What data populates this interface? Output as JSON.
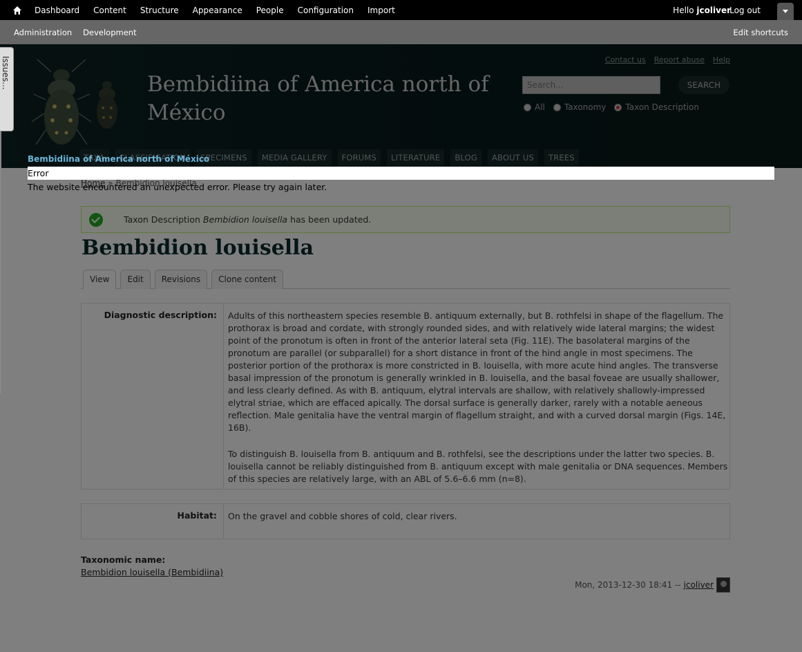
{
  "toolbar": {
    "menu": [
      "Dashboard",
      "Content",
      "Structure",
      "Appearance",
      "People",
      "Configuration",
      "Import"
    ],
    "hello_prefix": "Hello",
    "username": "jcoliver",
    "logout": "Log out",
    "shortcuts": [
      "Administration",
      "Development"
    ],
    "edit_shortcuts": "Edit shortcuts"
  },
  "header": {
    "site_name": "Bembidiina of America north of México",
    "secondary_links": [
      "Contact us",
      "Report abuse",
      "Help"
    ],
    "search_placeholder": "Search...",
    "search_button": "SEARCH",
    "search_options": [
      {
        "label": "All",
        "selected": false
      },
      {
        "label": "Taxonomy",
        "selected": false
      },
      {
        "label": "Taxon Description",
        "selected": true
      }
    ],
    "nav": [
      "TAXA",
      "CLASSIFICATION",
      "SPECIMENS",
      "MEDIA GALLERY",
      "FORUMS",
      "LITERATURE",
      "BLOG",
      "ABOUT US",
      "TREES"
    ]
  },
  "breadcrumb": {
    "home": "Home",
    "separator": "»",
    "current": "Bembidion louisella"
  },
  "status_message": {
    "prefix": "Taxon Description",
    "taxon": "Bembidion louisella",
    "suffix": "has been updated."
  },
  "page_title": "Bembidion louisella",
  "tabs": [
    "View",
    "Edit",
    "Revisions",
    "Clone content"
  ],
  "fields": {
    "diagnostic_label": "Diagnostic description:",
    "diagnostic_p1": "Adults of this northeastern species resemble B. antiquum externally, but B. rothfelsi in shape of the flagellum. The prothorax is broad and cordate, with strongly rounded sides, and with relatively wide lateral margins; the widest point of the pronotum is often in front of the anterior lateral seta (Fig. 11E). The basolateral margins of the pronotum are parallel (or subparallel) for a short distance in front of the hind angle in most specimens. The posterior portion of the prothorax is more constricted in B. louisella, with more acute hind angles. The transverse basal impression of the pronotum is generally wrinkled in B. louisella, and the basal foveae are usually shallower, and less clearly defined. As with B. antiquum, elytral intervals are shallow, with relatively shallowly-impressed elytral striae, which are effaced apically. The dorsal surface is generally darker, rarely with a notable aeneous reflection. Male genitalia have the ventral margin of flagellum straight, and with a curved dorsal margin (Figs. 14E, 16B).",
    "diagnostic_p2": "To distinguish B. louisella from B. antiquum and B. rothfelsi, see the descriptions under the latter two species. B. louisella cannot be reliably distinguished from B. antiquum except with male genitalia or DNA sequences. Members of this species are relatively large, with an ABL of 5.6–6.6 mm (n=8).",
    "habitat_label": "Habitat:",
    "habitat_value": "On the gravel and cobble shores of cold, clear rivers."
  },
  "taxonomic_name": {
    "label": "Taxonomic name:",
    "value": "Bembidion louisella (Bembidiina)"
  },
  "meta": {
    "date": "Mon, 2013-12-30 18:41 --",
    "author": "jcoliver"
  },
  "error_overlay": {
    "site_name": "Bembidiina of America north of México",
    "title": "Error",
    "message": "The website encountered an unexpected error. Please try again later."
  },
  "issues_tab": "Issues...",
  "colors": {
    "success_green": "#22aa22",
    "error_link_blue": "#6bb5d8",
    "header_bg": "#0c2222"
  }
}
